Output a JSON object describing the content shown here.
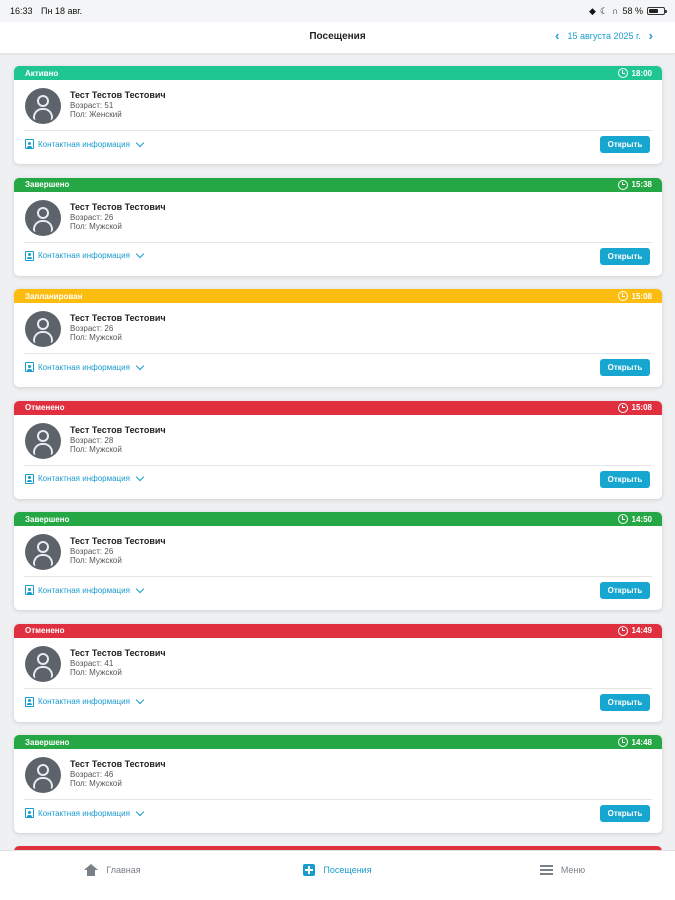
{
  "status_bar": {
    "time": "16:33",
    "date": "Пн 18 авг.",
    "battery": "58 %"
  },
  "header": {
    "title": "Посещения",
    "date": "15 августа 2025 г."
  },
  "colors": {
    "active": "#1fc691",
    "completed": "#24a744",
    "planned": "#fdbd10",
    "cancelled": "#e0303f",
    "accent": "#1a9ccf"
  },
  "visits": [
    {
      "status": "Активно",
      "status_key": "active",
      "time": "18:00",
      "name": "Тест Тестов Тестович",
      "age": "Возраст: 51",
      "sex": "Пол: Женский",
      "contact": "Контактная информация",
      "button": "Открыть"
    },
    {
      "status": "Завершено",
      "status_key": "completed",
      "time": "15:38",
      "name": "Тест Тестов Тестович",
      "age": "Возраст: 26",
      "sex": "Пол: Мужской",
      "contact": "Контактная информация",
      "button": "Открыть"
    },
    {
      "status": "Запланирован",
      "status_key": "planned",
      "time": "15:08",
      "name": "Тест Тестов Тестович",
      "age": "Возраст: 26",
      "sex": "Пол: Мужской",
      "contact": "Контактная информация",
      "button": "Открыть"
    },
    {
      "status": "Отменено",
      "status_key": "cancelled",
      "time": "15:08",
      "name": "Тест Тестов Тестович",
      "age": "Возраст: 28",
      "sex": "Пол: Мужской",
      "contact": "Контактная информация",
      "button": "Открыть"
    },
    {
      "status": "Завершено",
      "status_key": "completed",
      "time": "14:50",
      "name": "Тест Тестов Тестович",
      "age": "Возраст: 26",
      "sex": "Пол: Мужской",
      "contact": "Контактная информация",
      "button": "Открыть"
    },
    {
      "status": "Отменено",
      "status_key": "cancelled",
      "time": "14:49",
      "name": "Тест Тестов Тестович",
      "age": "Возраст: 41",
      "sex": "Пол: Мужской",
      "contact": "Контактная информация",
      "button": "Открыть"
    },
    {
      "status": "Завершено",
      "status_key": "completed",
      "time": "14:48",
      "name": "Тест Тестов Тестович",
      "age": "Возраст: 46",
      "sex": "Пол: Мужской",
      "contact": "Контактная информация",
      "button": "Открыть"
    }
  ],
  "tabs": [
    {
      "label": "Главная",
      "icon": "home-icon"
    },
    {
      "label": "Посещения",
      "icon": "visits-icon"
    },
    {
      "label": "Меню",
      "icon": "menu-icon"
    }
  ]
}
